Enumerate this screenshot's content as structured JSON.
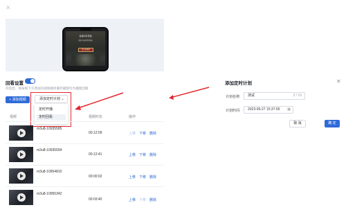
{
  "colors": {
    "accent": "#2f6bd8",
    "highlight": "#e4262d",
    "muted": "#9aa0aa"
  },
  "preview": {
    "phone_title": "直播间背景图",
    "phone_sub": "精彩内容即将开始",
    "badge": "正在直播中"
  },
  "replay": {
    "title": "回看设置",
    "toggle_on": true,
    "hint": "开启后，将按照下方添加的视频顺序循环播放作为播放回看"
  },
  "toolbar": {
    "add_video": "+ 添加视频",
    "plan_dropdown": "添加定时计划",
    "menu_items": [
      "定时开播",
      "定时回看"
    ]
  },
  "table": {
    "headers": [
      "视频",
      "视频时长",
      "操作"
    ],
    "actions": {
      "up": "上移",
      "down": "下移",
      "delete": "删除"
    },
    "rows": [
      {
        "name": "m3u8-10935585",
        "duration": "00:12:09",
        "up_disabled": true,
        "down_disabled": false
      },
      {
        "name": "m3u8-10935594",
        "duration": "00:12:41",
        "up_disabled": false,
        "down_disabled": false
      },
      {
        "name": "m3u8-10954810",
        "duration": "00:00:02",
        "up_disabled": false,
        "down_disabled": false
      },
      {
        "name": "m3u8-10955342",
        "duration": "00:03:40",
        "up_disabled": false,
        "down_disabled": true
      }
    ]
  },
  "dialog": {
    "title": "添加定时计划",
    "name_label": "计划名称:",
    "name_value": "测试",
    "name_count": "2 / 10",
    "time_label": "计划时间:",
    "time_value": "2023-06-27 15:37:00",
    "cancel": "取 消",
    "ok": "确 定"
  },
  "icons": {
    "close": "close-icon",
    "calendar": "calendar-icon",
    "chevron": "chevron-down-icon",
    "play": "play-icon"
  }
}
